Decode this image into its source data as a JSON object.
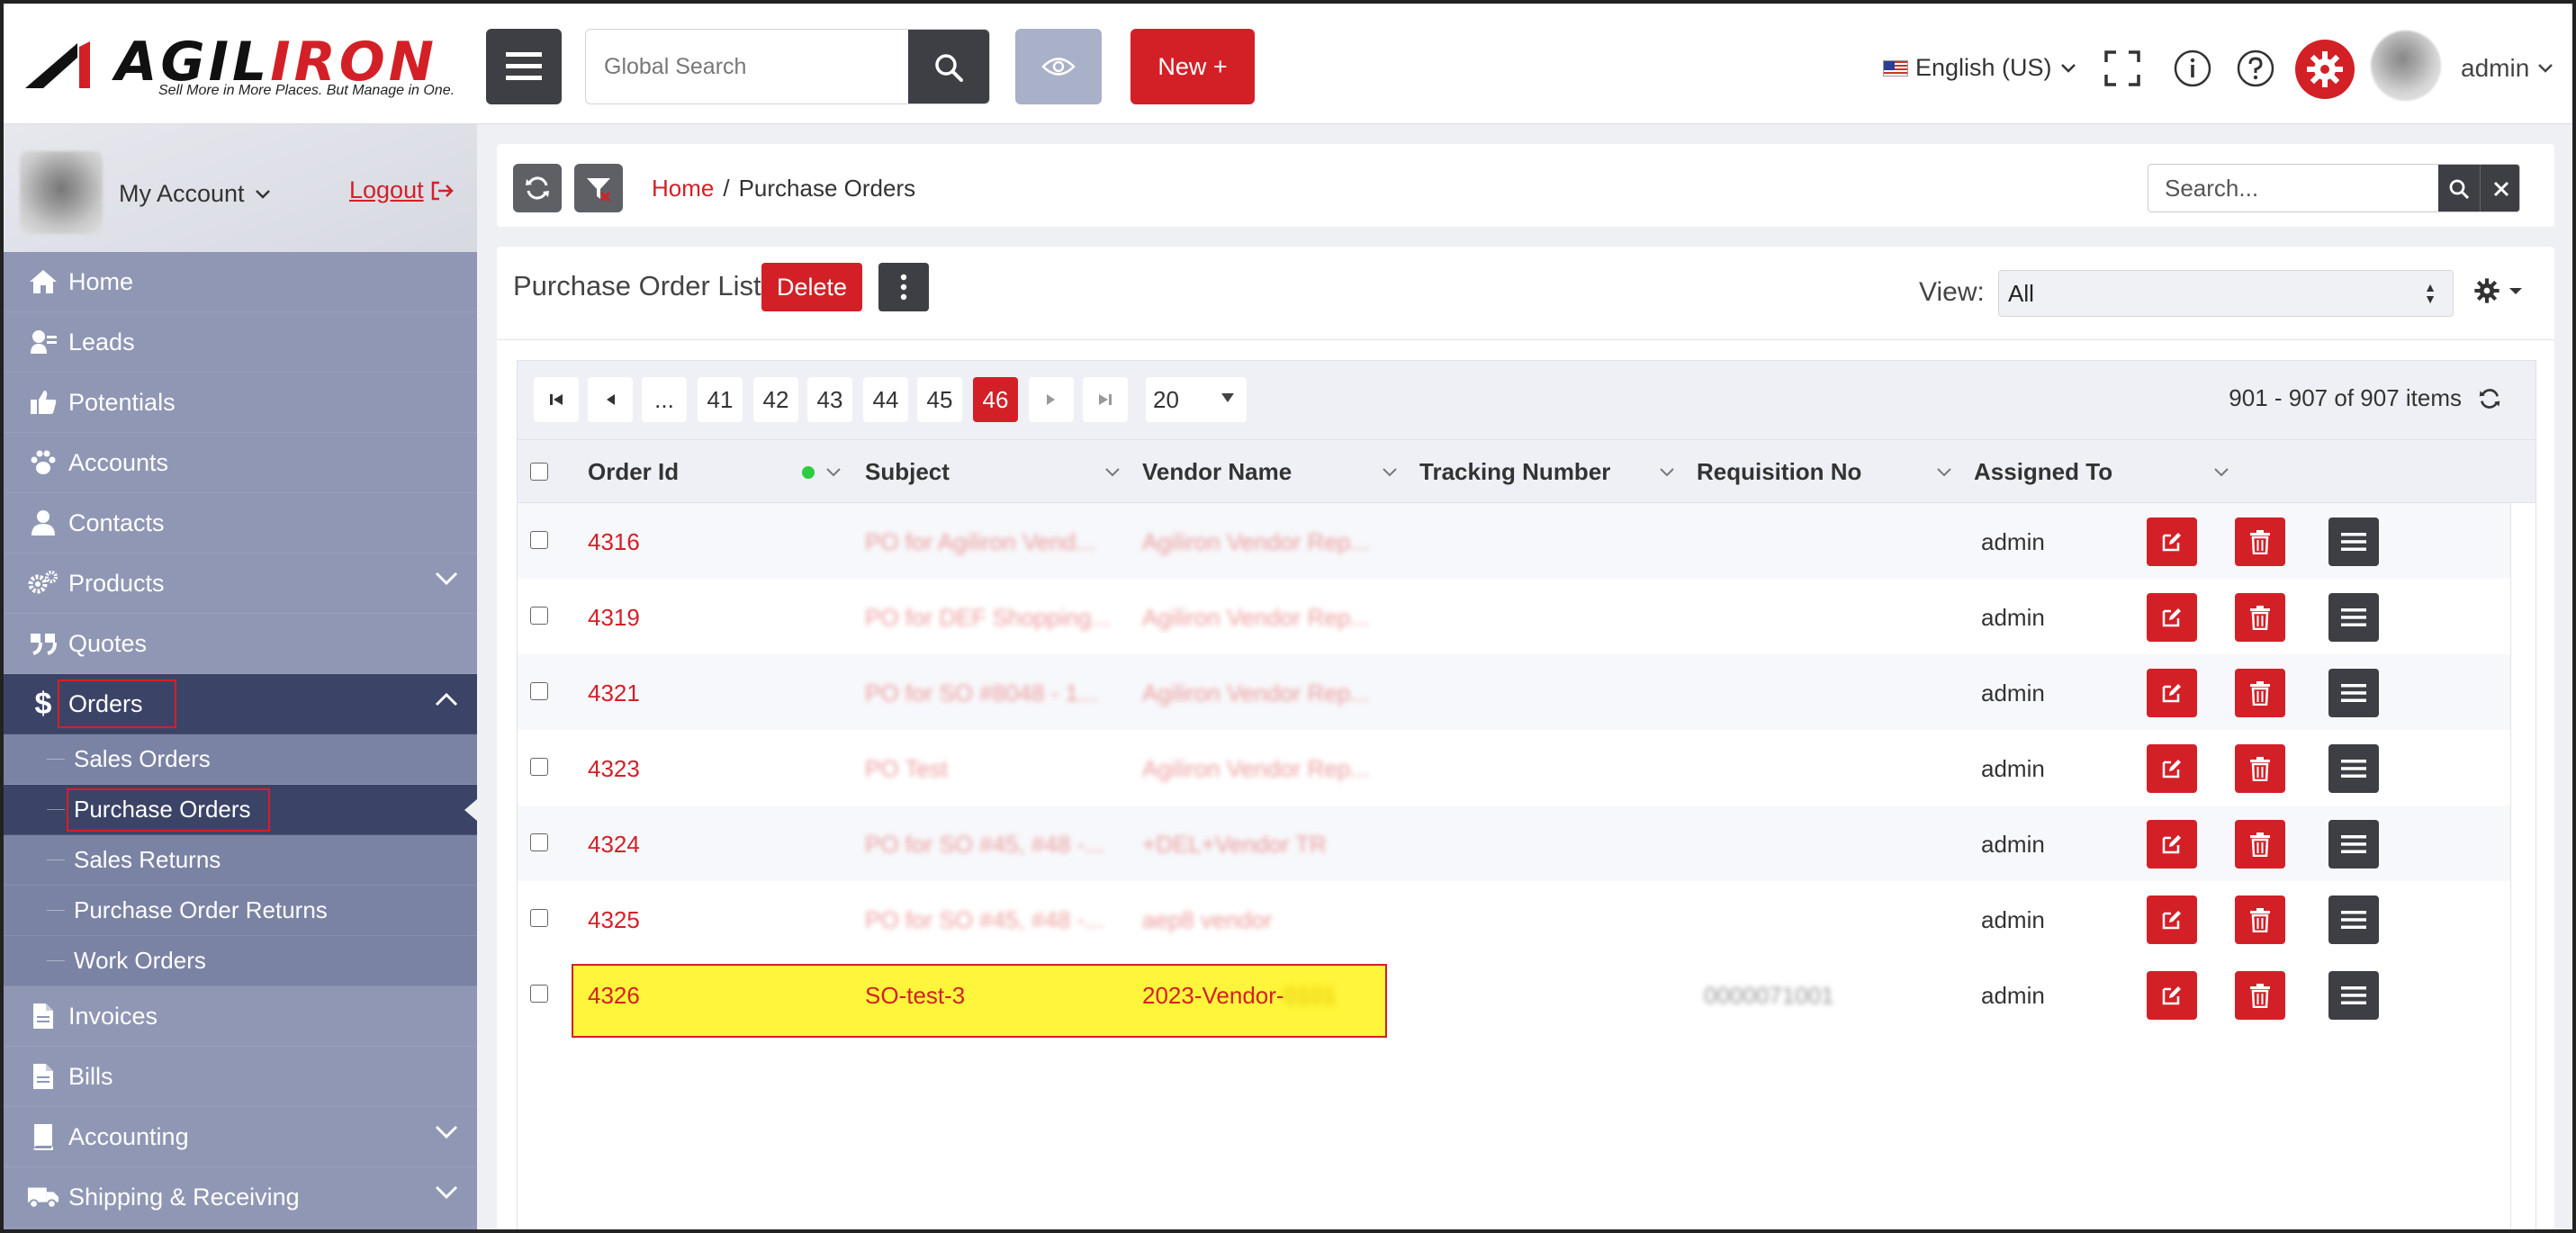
{
  "brand": {
    "name_left": "AGIL",
    "name_right": "IRON",
    "tagline": "Sell More in More Places. But Manage in One.",
    "accent": "#d32027",
    "sidebar_color": "#8f97b4",
    "active_color": "#3b4466"
  },
  "topbar": {
    "search_placeholder": "Global Search",
    "new_label": "New +",
    "language": "English (US)",
    "user": "admin"
  },
  "sidebar": {
    "my_account": "My Account",
    "logout": "Logout",
    "items": [
      {
        "label": "Home",
        "icon": "home-icon"
      },
      {
        "label": "Leads",
        "icon": "leads-icon"
      },
      {
        "label": "Potentials",
        "icon": "thumbs-up-icon"
      },
      {
        "label": "Accounts",
        "icon": "paw-icon"
      },
      {
        "label": "Contacts",
        "icon": "user-icon"
      },
      {
        "label": "Products",
        "icon": "gears-icon"
      },
      {
        "label": "Quotes",
        "icon": "quote-icon"
      },
      {
        "label": "Orders",
        "icon": "dollar-icon"
      },
      {
        "label": "Invoices",
        "icon": "file-icon"
      },
      {
        "label": "Bills",
        "icon": "file-icon"
      },
      {
        "label": "Accounting",
        "icon": "book-icon"
      },
      {
        "label": "Shipping & Receiving",
        "icon": "truck-icon"
      }
    ],
    "orders_sub": [
      "Sales Orders",
      "Purchase Orders",
      "Sales Returns",
      "Purchase Order Returns",
      "Work Orders"
    ]
  },
  "breadcrumb": {
    "home": "Home",
    "sep": "/",
    "current": "Purchase Orders"
  },
  "list_search_placeholder": "Search...",
  "panel": {
    "title": "Purchase Order List",
    "delete_label": "Delete",
    "view_label": "View:",
    "view_value": "All"
  },
  "pager": {
    "ellipsis": "...",
    "pages": [
      "41",
      "42",
      "43",
      "44",
      "45",
      "46"
    ],
    "current": "46",
    "page_size": "20",
    "items_text": "901 - 907 of 907 items"
  },
  "columns": [
    "Order Id",
    "Subject",
    "Vendor Name",
    "Tracking Number",
    "Requisition No",
    "Assigned To"
  ],
  "rows": [
    {
      "id": "4316",
      "subject": "PO for Agiliron Vend...",
      "vendor": "Agiliron Vendor Rep...",
      "req": "",
      "assigned": "admin"
    },
    {
      "id": "4319",
      "subject": "PO for DEF Shopping...",
      "vendor": "Agiliron Vendor Rep...",
      "req": "",
      "assigned": "admin"
    },
    {
      "id": "4321",
      "subject": "PO for SO #8048 - 1...",
      "vendor": "Agiliron Vendor Rep...",
      "req": "",
      "assigned": "admin"
    },
    {
      "id": "4323",
      "subject": "PO Test",
      "vendor": "Agiliron Vendor Rep...",
      "req": "",
      "assigned": "admin"
    },
    {
      "id": "4324",
      "subject": "PO for SO #45, #48 -...",
      "vendor": "+DEL+Vendor TR",
      "req": "",
      "assigned": "admin"
    },
    {
      "id": "4325",
      "subject": "PO for SO #45, #48 -...",
      "vendor": "aep8 vendor",
      "req": "",
      "assigned": "admin"
    },
    {
      "id": "4326",
      "subject": "SO-test-3",
      "vendor": "2023-Vendor-",
      "vendor_suffix": "0101",
      "req": "0000071001",
      "assigned": "admin"
    }
  ]
}
